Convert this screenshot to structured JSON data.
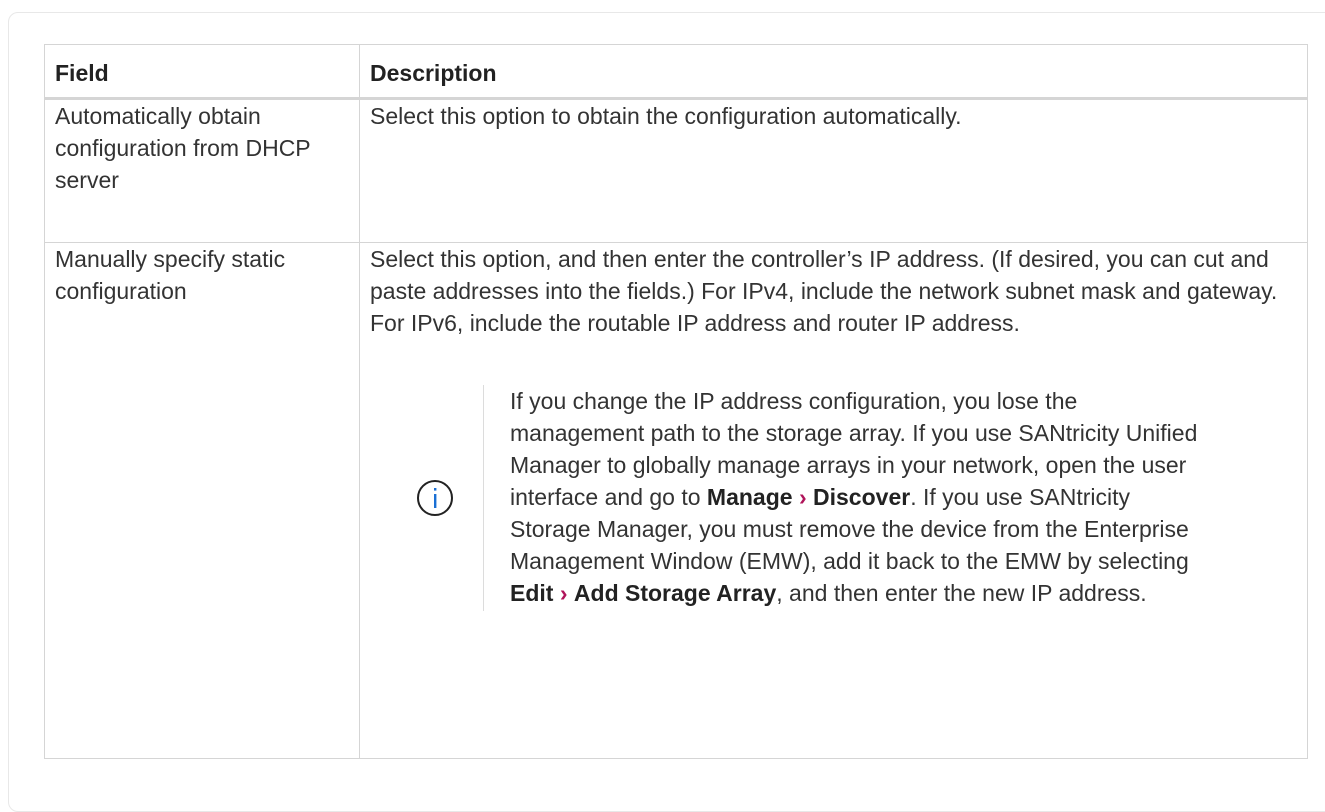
{
  "table": {
    "headers": [
      "Field",
      "Description"
    ],
    "rows": [
      {
        "field": "Automatically obtain configuration from DHCP server",
        "description": "Select this option to obtain the configuration automatically."
      },
      {
        "field": "Manually specify static configuration",
        "description": "Select this option, and then enter the controller’s IP address. (If desired, you can cut and paste addresses into the fields.) For IPv4, include the network subnet mask and gateway. For IPv6, include the routable IP address and router IP address."
      }
    ]
  },
  "note": {
    "icon": "info-icon",
    "part1": "If you change the IP address configuration, you lose the management path to the storage array. If you use SANtricity Unified Manager to globally manage arrays in your network, open the user interface and go to ",
    "menu1_a": "Manage",
    "sep1": "›",
    "menu1_b": "Discover",
    "part2": ". If you use SANtricity Storage Manager, you must remove the device from the Enterprise Management Window (EMW), add it back to the EMW by selecting ",
    "menu2_a": "Edit",
    "sep2": "›",
    "menu2_b": "Add Storage Array",
    "part3": ", and then enter the new IP address."
  },
  "colors": {
    "separator": "#b0145a",
    "border": "#d5d5d5",
    "text": "#333333"
  }
}
